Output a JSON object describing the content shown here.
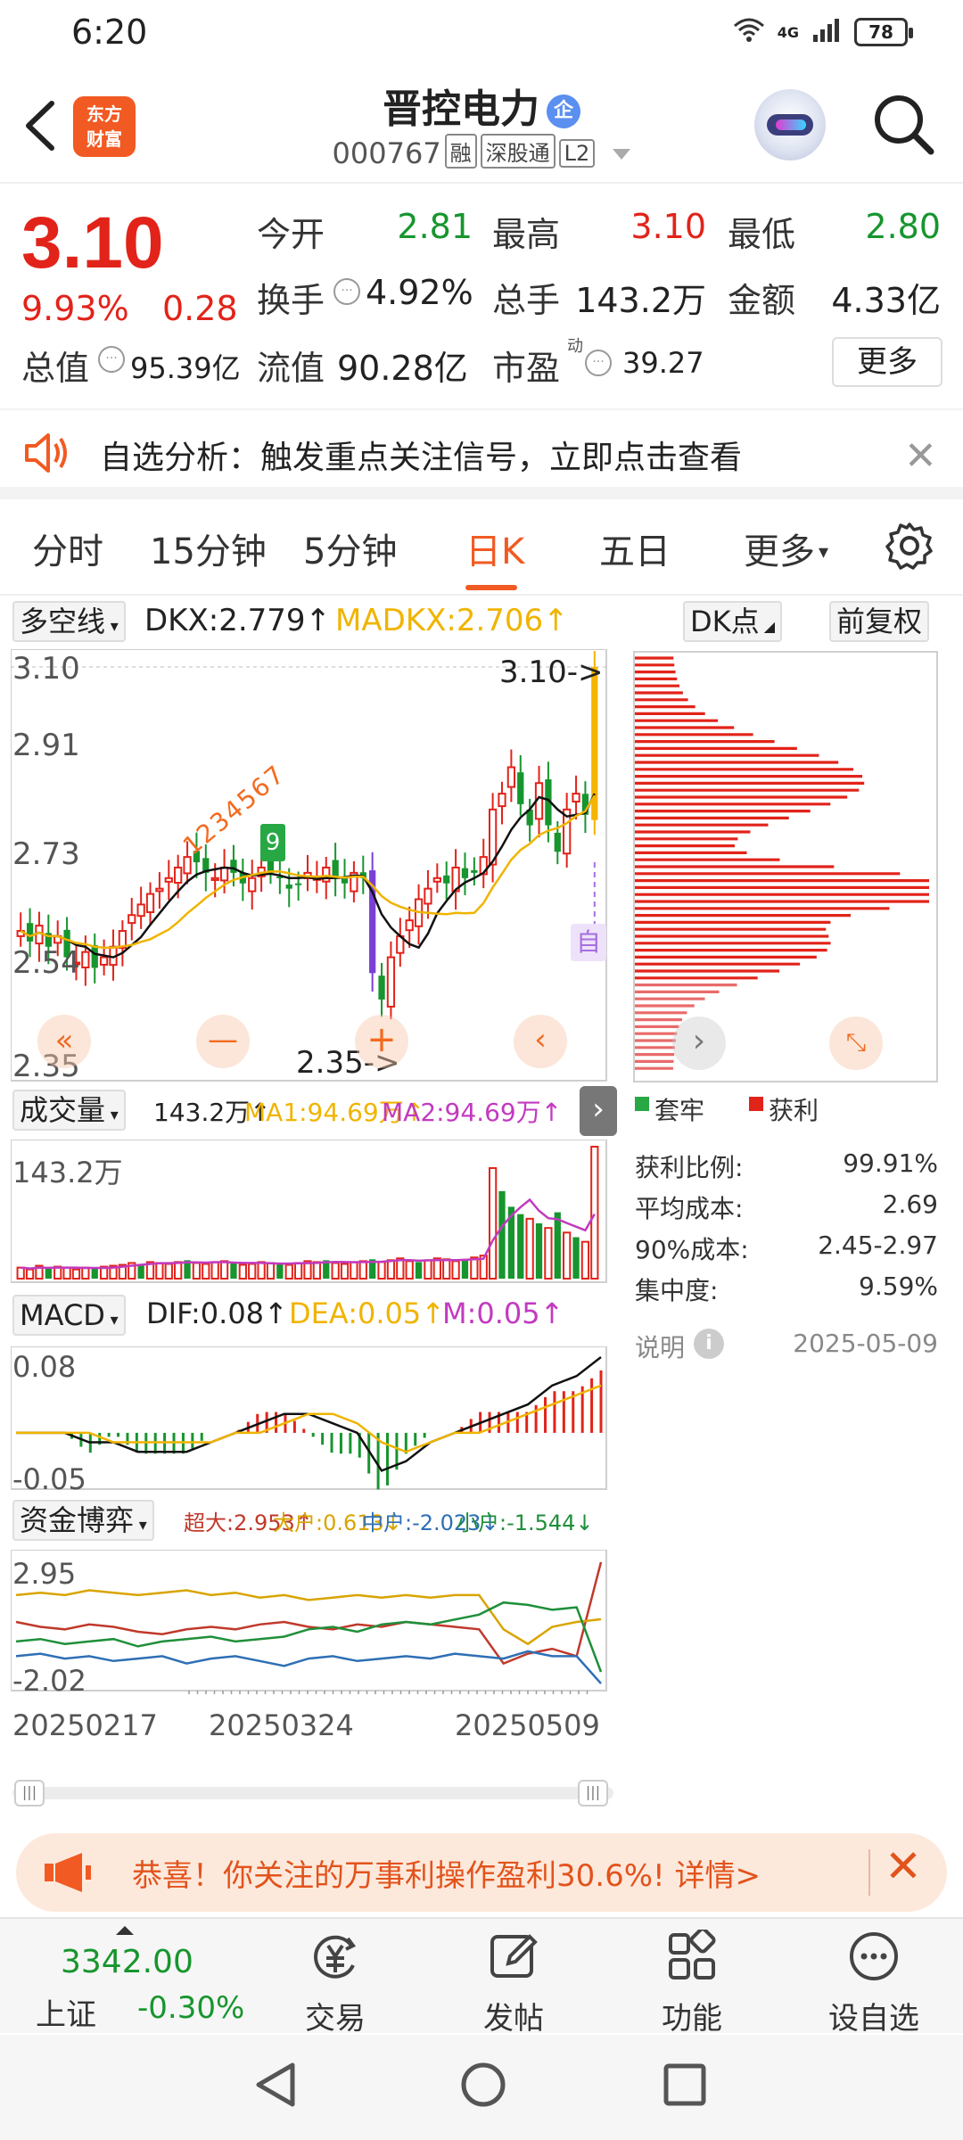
{
  "status": {
    "time": "6:20",
    "network": "4G",
    "battery": "78"
  },
  "header": {
    "app_logo_line1": "东方",
    "app_logo_line2": "财富",
    "stock_name": "晋控电力",
    "ent_badge": "企",
    "stock_code": "000767",
    "tags": [
      "融",
      "深股通",
      "L2"
    ]
  },
  "quote": {
    "price": "3.10",
    "pct_change": "9.93%",
    "abs_change": "0.28",
    "open_label": "今开",
    "open": "2.81",
    "high_label": "最高",
    "high": "3.10",
    "low_label": "最低",
    "low": "2.80",
    "turnover_label": "换手",
    "turnover": "4.92%",
    "volume_label": "总手",
    "volume": "143.2万",
    "amount_label": "金额",
    "amount": "4.33亿",
    "mktcap_label": "总值",
    "mktcap": "95.39亿",
    "float_label": "流值",
    "float_cap": "90.28亿",
    "pe_label": "市盈",
    "pe_sup": "动",
    "pe": "39.27",
    "more_label": "更多"
  },
  "alert_banner": {
    "text": "自选分析：触发重点关注信号，立即点击查看"
  },
  "tabs": {
    "items": [
      "分时",
      "15分钟",
      "5分钟",
      "日K",
      "五日",
      "更多"
    ],
    "active": "日K"
  },
  "kline": {
    "indicator_select": "多空线",
    "dkx_label": "DKX:2.779↑",
    "madkx_label": "MADKX:2.706↑",
    "dk_button": "DK点",
    "adjust_button": "前复权",
    "y_ticks": [
      "3.10",
      "2.91",
      "2.73",
      "2.54",
      "2.35"
    ],
    "high_marker": "3.10->",
    "low_marker": "2.35->",
    "tag_9": "9",
    "seq_labels": "1234567",
    "auto_tag": "自"
  },
  "volume": {
    "select": "成交量",
    "vol_label": "143.2万↑",
    "ma1_label": "MA1:94.69万↑",
    "ma2_label": "MA2:94.69万↑",
    "y_top": "143.2万"
  },
  "macd": {
    "select": "MACD",
    "dif_label": "DIF:0.08↑",
    "dea_label": "DEA:0.05↑",
    "m_label": "M:0.05↑",
    "y_top": "0.08",
    "y_bottom": "-0.05"
  },
  "fund": {
    "select": "资金博弈",
    "super_label": "超大:2.953↑",
    "big_label": "大户:0.613↓",
    "mid_label": "中户:-2.023↓",
    "small_label": "小户:-1.544↓",
    "y_top": "2.95",
    "y_bottom": "-2.02"
  },
  "dates": [
    "20250217",
    "20250324",
    "20250509"
  ],
  "chip": {
    "legend_trapped": "套牢",
    "legend_profit": "获利",
    "rows": [
      {
        "label": "获利比例:",
        "value": "99.91%"
      },
      {
        "label": "平均成本:",
        "value": "2.69"
      },
      {
        "label": "90%成本:",
        "value": "2.45-2.97"
      },
      {
        "label": "集中度:",
        "value": "9.59%"
      }
    ],
    "note_label": "说明",
    "date": "2025-05-09"
  },
  "promo": {
    "text": "恭喜！你关注的万事利操作盈利30.6%! 详情>"
  },
  "bottom_nav": {
    "index_value": "3342.00",
    "index_name": "上证",
    "index_change": "-0.30%",
    "items": [
      "交易",
      "发帖",
      "功能",
      "设自选"
    ]
  },
  "colors": {
    "up": "#e2231a",
    "down": "#17952e",
    "accent": "#f15a22",
    "purple": "#8e44ad"
  },
  "chart_data": [
    {
      "type": "candlestick",
      "title": "",
      "ylim": [
        2.35,
        3.1
      ],
      "close": [
        2.6,
        2.58,
        2.61,
        2.57,
        2.59,
        2.55,
        2.54,
        2.56,
        2.53,
        2.55,
        2.57,
        2.6,
        2.63,
        2.65,
        2.67,
        2.68,
        2.7,
        2.72,
        2.74,
        2.73,
        2.71,
        2.7,
        2.72,
        2.71,
        2.69,
        2.7,
        2.72,
        2.71,
        2.7,
        2.68,
        2.69,
        2.71,
        2.7,
        2.72,
        2.7,
        2.69,
        2.71,
        2.7,
        2.52,
        2.47,
        2.55,
        2.59,
        2.62,
        2.66,
        2.68,
        2.7,
        2.69,
        2.72,
        2.7,
        2.71,
        2.74,
        2.83,
        2.86,
        2.91,
        2.84,
        2.8,
        2.88,
        2.8,
        2.75,
        2.83,
        2.86,
        2.82,
        3.1
      ],
      "dkx_last": 2.779,
      "madkx_last": 2.706
    },
    {
      "type": "bar",
      "title": "",
      "ylim": [
        0,
        143.2
      ],
      "values": [
        12,
        10,
        14,
        11,
        13,
        12,
        10,
        12,
        11,
        13,
        14,
        15,
        17,
        16,
        18,
        17,
        16,
        18,
        20,
        17,
        16,
        18,
        19,
        17,
        15,
        16,
        18,
        17,
        16,
        15,
        17,
        19,
        18,
        20,
        17,
        16,
        18,
        19,
        21,
        18,
        20,
        22,
        19,
        18,
        20,
        22,
        21,
        19,
        20,
        23,
        25,
        120,
        95,
        78,
        70,
        65,
        60,
        55,
        72,
        50,
        45,
        40,
        143.2
      ],
      "ma_last": 94.69
    },
    {
      "type": "line",
      "title": "",
      "ylim": [
        -0.05,
        0.08
      ],
      "series": [
        {
          "name": "DIF",
          "values": [
            0.0,
            0.0,
            0.0,
            -0.01,
            -0.01,
            -0.02,
            -0.02,
            -0.02,
            -0.01,
            0.0,
            0.01,
            0.02,
            0.02,
            0.01,
            0.0,
            -0.04,
            -0.03,
            -0.01,
            0.0,
            0.01,
            0.02,
            0.03,
            0.05,
            0.06,
            0.08
          ]
        },
        {
          "name": "DEA",
          "values": [
            0.0,
            0.0,
            0.0,
            0.0,
            -0.01,
            -0.01,
            -0.01,
            -0.01,
            -0.01,
            0.0,
            0.0,
            0.01,
            0.02,
            0.02,
            0.01,
            -0.01,
            -0.02,
            -0.01,
            0.0,
            0.0,
            0.01,
            0.02,
            0.03,
            0.04,
            0.05
          ]
        }
      ]
    },
    {
      "type": "line",
      "title": "",
      "ylim": [
        -2.02,
        2.95
      ],
      "series": [
        {
          "name": "超大",
          "values": [
            0.5,
            0.3,
            0.2,
            0.4,
            0.3,
            0.1,
            0.0,
            0.2,
            0.3,
            0.2,
            0.4,
            0.5,
            0.3,
            0.2,
            0.4,
            0.3,
            0.5,
            0.4,
            0.3,
            0.2,
            -1.2,
            -0.8,
            -0.6,
            -0.9,
            2.953
          ]
        },
        {
          "name": "大户",
          "values": [
            1.6,
            1.7,
            1.6,
            1.8,
            1.7,
            1.6,
            1.7,
            1.8,
            1.6,
            1.7,
            1.5,
            1.6,
            1.4,
            1.5,
            1.6,
            1.5,
            1.6,
            1.5,
            1.6,
            1.6,
            0.2,
            -0.4,
            0.3,
            0.5,
            0.613
          ]
        },
        {
          "name": "中户",
          "values": [
            -0.9,
            -0.8,
            -1.0,
            -0.9,
            -1.1,
            -1.0,
            -0.9,
            -1.2,
            -1.0,
            -0.9,
            -1.1,
            -1.3,
            -1.0,
            -0.9,
            -1.1,
            -1.0,
            -0.9,
            -1.0,
            -0.8,
            -0.9,
            -1.0,
            -0.7,
            -0.9,
            -0.9,
            -2.023
          ]
        },
        {
          "name": "小户",
          "values": [
            -0.3,
            -0.2,
            -0.4,
            -0.3,
            -0.2,
            -0.5,
            -0.3,
            -0.2,
            -0.1,
            -0.3,
            -0.2,
            -0.1,
            0.2,
            0.3,
            0.1,
            0.4,
            0.5,
            0.4,
            0.6,
            0.8,
            1.3,
            1.2,
            1.0,
            1.1,
            -1.544
          ]
        }
      ]
    }
  ]
}
